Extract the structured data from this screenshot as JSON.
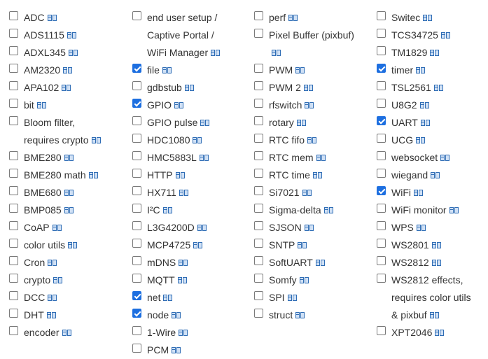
{
  "doc_icon": "documentation-icon",
  "accent_color": "#1d6fe0",
  "columns": [
    [
      {
        "lines": [
          "ADC"
        ],
        "checked": false
      },
      {
        "lines": [
          "ADS1115"
        ],
        "checked": false
      },
      {
        "lines": [
          "ADXL345"
        ],
        "checked": false
      },
      {
        "lines": [
          "AM2320"
        ],
        "checked": false
      },
      {
        "lines": [
          "APA102"
        ],
        "checked": false
      },
      {
        "lines": [
          "bit"
        ],
        "checked": false
      },
      {
        "lines": [
          "Bloom filter,",
          "requires crypto"
        ],
        "checked": false
      },
      {
        "lines": [
          "BME280"
        ],
        "checked": false
      },
      {
        "lines": [
          "BME280 math"
        ],
        "checked": false
      },
      {
        "lines": [
          "BME680"
        ],
        "checked": false
      },
      {
        "lines": [
          "BMP085"
        ],
        "checked": false
      },
      {
        "lines": [
          "CoAP"
        ],
        "checked": false
      },
      {
        "lines": [
          "color utils"
        ],
        "checked": false
      },
      {
        "lines": [
          "Cron"
        ],
        "checked": false
      },
      {
        "lines": [
          "crypto"
        ],
        "checked": false
      },
      {
        "lines": [
          "DCC"
        ],
        "checked": false
      },
      {
        "lines": [
          "DHT"
        ],
        "checked": false
      },
      {
        "lines": [
          "encoder"
        ],
        "checked": false
      }
    ],
    [
      {
        "lines": [
          "end user setup /",
          "Captive Portal /",
          "WiFi Manager"
        ],
        "checked": false
      },
      {
        "lines": [
          "file"
        ],
        "checked": true
      },
      {
        "lines": [
          "gdbstub"
        ],
        "checked": false
      },
      {
        "lines": [
          "GPIO"
        ],
        "checked": true
      },
      {
        "lines": [
          "GPIO pulse"
        ],
        "checked": false
      },
      {
        "lines": [
          "HDC1080"
        ],
        "checked": false
      },
      {
        "lines": [
          "HMC5883L"
        ],
        "checked": false
      },
      {
        "lines": [
          "HTTP"
        ],
        "checked": false
      },
      {
        "lines": [
          "HX711"
        ],
        "checked": false
      },
      {
        "lines": [
          "I²C"
        ],
        "checked": false
      },
      {
        "lines": [
          "L3G4200D"
        ],
        "checked": false
      },
      {
        "lines": [
          "MCP4725"
        ],
        "checked": false
      },
      {
        "lines": [
          "mDNS"
        ],
        "checked": false
      },
      {
        "lines": [
          "MQTT"
        ],
        "checked": false
      },
      {
        "lines": [
          "net"
        ],
        "checked": true
      },
      {
        "lines": [
          "node"
        ],
        "checked": true
      },
      {
        "lines": [
          "1-Wire"
        ],
        "checked": false
      },
      {
        "lines": [
          "PCM"
        ],
        "checked": false
      }
    ],
    [
      {
        "lines": [
          "perf"
        ],
        "checked": false
      },
      {
        "lines": [
          "Pixel Buffer (pixbuf)"
        ],
        "checked": false,
        "icon_next_line": true
      },
      {
        "lines": [
          "PWM"
        ],
        "checked": false
      },
      {
        "lines": [
          "PWM 2"
        ],
        "checked": false
      },
      {
        "lines": [
          "rfswitch"
        ],
        "checked": false
      },
      {
        "lines": [
          "rotary"
        ],
        "checked": false
      },
      {
        "lines": [
          "RTC fifo"
        ],
        "checked": false
      },
      {
        "lines": [
          "RTC mem"
        ],
        "checked": false
      },
      {
        "lines": [
          "RTC time"
        ],
        "checked": false
      },
      {
        "lines": [
          "Si7021"
        ],
        "checked": false
      },
      {
        "lines": [
          "Sigma-delta"
        ],
        "checked": false
      },
      {
        "lines": [
          "SJSON"
        ],
        "checked": false
      },
      {
        "lines": [
          "SNTP"
        ],
        "checked": false
      },
      {
        "lines": [
          "SoftUART"
        ],
        "checked": false
      },
      {
        "lines": [
          "Somfy"
        ],
        "checked": false
      },
      {
        "lines": [
          "SPI"
        ],
        "checked": false
      },
      {
        "lines": [
          "struct"
        ],
        "checked": false
      }
    ],
    [
      {
        "lines": [
          "Switec"
        ],
        "checked": false
      },
      {
        "lines": [
          "TCS34725"
        ],
        "checked": false
      },
      {
        "lines": [
          "TM1829"
        ],
        "checked": false
      },
      {
        "lines": [
          "timer"
        ],
        "checked": true
      },
      {
        "lines": [
          "TSL2561"
        ],
        "checked": false
      },
      {
        "lines": [
          "U8G2"
        ],
        "checked": false
      },
      {
        "lines": [
          "UART"
        ],
        "checked": true
      },
      {
        "lines": [
          "UCG"
        ],
        "checked": false
      },
      {
        "lines": [
          "websocket"
        ],
        "checked": false
      },
      {
        "lines": [
          "wiegand"
        ],
        "checked": false
      },
      {
        "lines": [
          "WiFi"
        ],
        "checked": true
      },
      {
        "lines": [
          "WiFi monitor"
        ],
        "checked": false
      },
      {
        "lines": [
          "WPS"
        ],
        "checked": false
      },
      {
        "lines": [
          "WS2801"
        ],
        "checked": false
      },
      {
        "lines": [
          "WS2812"
        ],
        "checked": false
      },
      {
        "lines": [
          "WS2812 effects,",
          "requires color utils",
          "& pixbuf"
        ],
        "checked": false
      },
      {
        "lines": [
          "XPT2046"
        ],
        "checked": false
      }
    ]
  ]
}
